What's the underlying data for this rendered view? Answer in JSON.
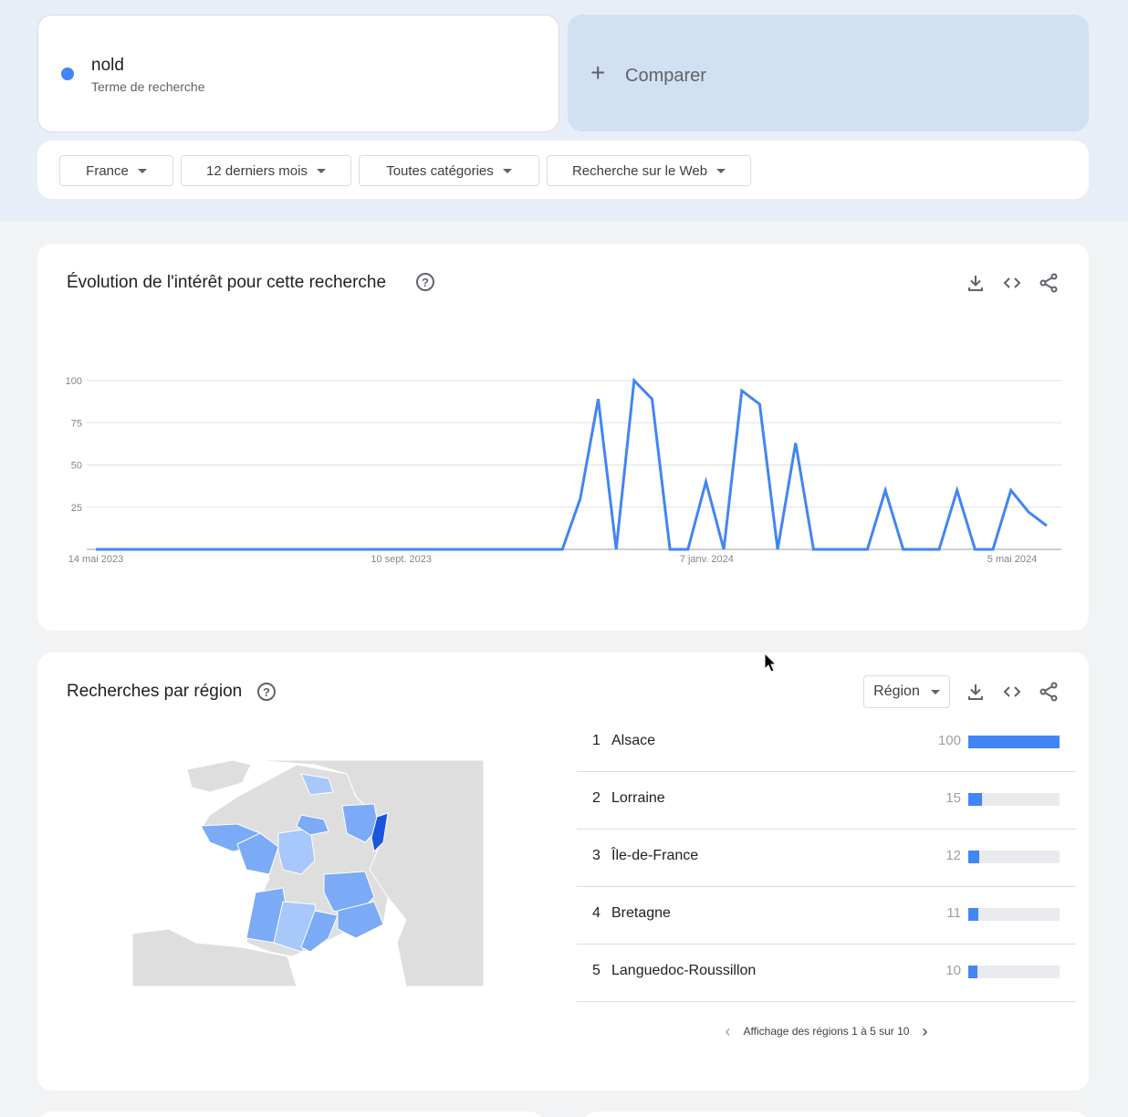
{
  "search": {
    "term": "nold",
    "term_type": "Terme de recherche",
    "term_color": "#4285f4",
    "compare_label": "Comparer"
  },
  "filters": [
    {
      "label": "France"
    },
    {
      "label": "12 derniers mois"
    },
    {
      "label": "Toutes catégories"
    },
    {
      "label": "Recherche sur le Web"
    }
  ],
  "interest": {
    "title": "Évolution de l'intérêt pour cette recherche",
    "help_glyph": "?"
  },
  "chart_data": {
    "type": "line",
    "title": "Évolution de l'intérêt pour cette recherche",
    "xlabel": "",
    "ylabel": "",
    "ylim": [
      0,
      100
    ],
    "yticks": [
      25,
      50,
      75,
      100
    ],
    "xtick_labels": [
      "14 mai 2023",
      "10 sept. 2023",
      "7 janv. 2024",
      "5 mai 2024"
    ],
    "series": [
      {
        "color": "#4285f4",
        "values": [
          0,
          0,
          0,
          0,
          0,
          0,
          0,
          0,
          0,
          0,
          0,
          0,
          0,
          0,
          0,
          0,
          0,
          0,
          0,
          0,
          0,
          0,
          0,
          0,
          0,
          0,
          0,
          30,
          89,
          0,
          100,
          89,
          0,
          0,
          40,
          0,
          94,
          86,
          0,
          63,
          0,
          0,
          0,
          0,
          35,
          0,
          0,
          0,
          35,
          0,
          0,
          35,
          22,
          14
        ]
      }
    ]
  },
  "regions": {
    "title": "Recherches par région",
    "help_glyph": "?",
    "dropdown_label": "Région",
    "rows": [
      {
        "rank": "1",
        "name": "Alsace",
        "value": 100,
        "value_label": "100"
      },
      {
        "rank": "2",
        "name": "Lorraine",
        "value": 15,
        "value_label": "15"
      },
      {
        "rank": "3",
        "name": "Île-de-France",
        "value": 12,
        "value_label": "12"
      },
      {
        "rank": "4",
        "name": "Bretagne",
        "value": 11,
        "value_label": "11"
      },
      {
        "rank": "5",
        "name": "Languedoc-Roussillon",
        "value": 10,
        "value_label": "10"
      }
    ],
    "pager_text": "Affichage des régions 1 à 5 sur 10",
    "bar_color": "#4285f4",
    "map_colors": {
      "high": "#1a56db",
      "medium": "#7baaf7",
      "low": "#a8c7fa",
      "none": "#dedede"
    }
  }
}
